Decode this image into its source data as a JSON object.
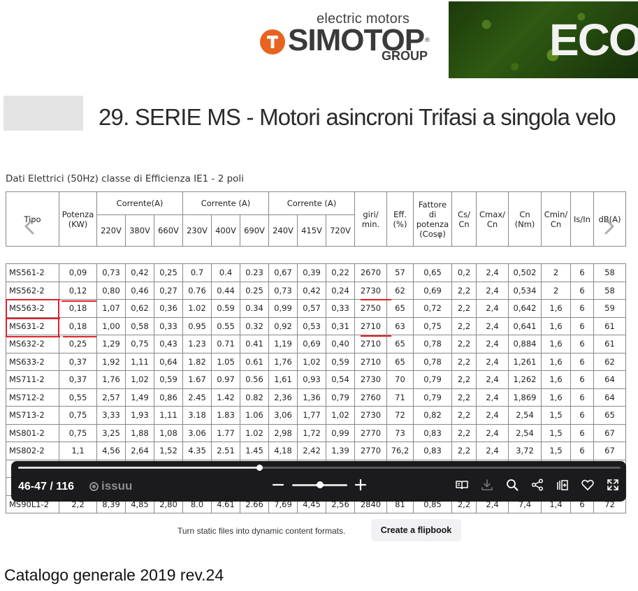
{
  "header": {
    "brand_tagline": "electric motors",
    "brand_name": "SIMOTOP",
    "brand_registered": "®",
    "brand_group": "GROUP",
    "eco_label": "ECO"
  },
  "page": {
    "section_title": "29. SERIE MS - Motori asincroni Trifasi a singola velo",
    "table_caption": "Dati Elettrici (50Hz) classe di Efficienza IE1 - 2 poli"
  },
  "table": {
    "headers": {
      "tipo": "Tipo",
      "potenza": "Potenza",
      "potenza_unit": "(KW)",
      "corrente_a": "Corrente(A)",
      "corrente_b": "Corrente (A)",
      "corrente_c": "Corrente (A)",
      "giri": "giri/",
      "giri_unit": "min.",
      "eff": "Eff.",
      "eff_unit": "(%)",
      "fattore": "Fattore",
      "fattore_2": "di",
      "fattore_3": "potenza",
      "fattore_4": "(Cosφ)",
      "cs": "Cs/",
      "cs_2": "Cn",
      "cmax": "Cmax/",
      "cmax_2": "Cn",
      "cn": "Cn",
      "cn_2": "(Nm)",
      "cmin": "Cmin/",
      "cmin_2": "Cn",
      "isin": "Is/In",
      "db": "dB(A)",
      "v": [
        "220V",
        "380V",
        "660V",
        "230V",
        "400V",
        "690V",
        "240V",
        "415V",
        "720V"
      ]
    },
    "rows": [
      [
        "MS561-2",
        "0,09",
        "0,73",
        "0,42",
        "0,25",
        "0.7",
        "0.4",
        "0.23",
        "0,67",
        "0,39",
        "0,22",
        "2670",
        "57",
        "0,65",
        "0,2",
        "2,4",
        "0,502",
        "2",
        "6",
        "58"
      ],
      [
        "MS562-2",
        "0,12",
        "0,80",
        "0,46",
        "0,27",
        "0.76",
        "0.44",
        "0.25",
        "0,73",
        "0,42",
        "0,24",
        "2730",
        "62",
        "0,69",
        "2,2",
        "2,4",
        "0,534",
        "2",
        "6",
        "58"
      ],
      [
        "MS563-2",
        "0,18",
        "1,07",
        "0,62",
        "0,36",
        "1.02",
        "0.59",
        "0.34",
        "0,99",
        "0,57",
        "0,33",
        "2750",
        "65",
        "0,72",
        "2,2",
        "2,4",
        "0,642",
        "1,6",
        "6",
        "59"
      ],
      [
        "MS631-2",
        "0,18",
        "1,00",
        "0,58",
        "0,33",
        "0.95",
        "0.55",
        "0.32",
        "0,92",
        "0,53",
        "0,31",
        "2710",
        "63",
        "0,75",
        "2,2",
        "2,4",
        "0,641",
        "1,6",
        "6",
        "61"
      ],
      [
        "MS632-2",
        "0,25",
        "1,29",
        "0,75",
        "0,43",
        "1.23",
        "0.71",
        "0.41",
        "1,19",
        "0,69",
        "0,40",
        "2710",
        "65",
        "0,78",
        "2,2",
        "2,4",
        "0,884",
        "1,6",
        "6",
        "61"
      ],
      [
        "MS633-2",
        "0,37",
        "1,92",
        "1,11",
        "0,64",
        "1.82",
        "1.05",
        "0.61",
        "1,76",
        "1,02",
        "0,59",
        "2710",
        "65",
        "0,78",
        "2,2",
        "2,4",
        "1,261",
        "1,6",
        "6",
        "62"
      ],
      [
        "MS711-2",
        "0,37",
        "1,76",
        "1,02",
        "0,59",
        "1.67",
        "0.97",
        "0.56",
        "1,61",
        "0,93",
        "0,54",
        "2730",
        "70",
        "0,79",
        "2,2",
        "2,4",
        "1,262",
        "1,6",
        "6",
        "64"
      ],
      [
        "MS712-2",
        "0,55",
        "2,57",
        "1,49",
        "0,86",
        "2.45",
        "1.42",
        "0.82",
        "2,36",
        "1,36",
        "0,79",
        "2760",
        "71",
        "0,79",
        "2,2",
        "2,4",
        "1,869",
        "1,6",
        "6",
        "64"
      ],
      [
        "MS713-2",
        "0,75",
        "3,33",
        "1,93",
        "1,11",
        "3.18",
        "1.83",
        "1.06",
        "3,06",
        "1,77",
        "1,02",
        "2730",
        "72",
        "0,82",
        "2,2",
        "2,4",
        "2,54",
        "1,5",
        "6",
        "65"
      ],
      [
        "MS801-2",
        "0,75",
        "3,25",
        "1,88",
        "1,08",
        "3.06",
        "1.77",
        "1.02",
        "2,98",
        "1,72",
        "0,99",
        "2770",
        "73",
        "0,83",
        "2,2",
        "2,4",
        "2,54",
        "1,5",
        "6",
        "67"
      ],
      [
        "MS802-2",
        "1,1",
        "4,56",
        "2,64",
        "1,52",
        "4.35",
        "2.51",
        "1.45",
        "4,18",
        "2,42",
        "1,39",
        "2770",
        "76,2",
        "0,83",
        "2,2",
        "2,4",
        "3,72",
        "1,5",
        "6",
        "67"
      ],
      [
        "",
        "",
        "",
        "",
        "",
        "",
        "",
        "",
        "",
        "",
        "",
        "",
        "",
        "",
        "",
        "",
        "",
        "",
        "",
        ""
      ],
      [
        "",
        "",
        "",
        "",
        "",
        "",
        "",
        "",
        "",
        "",
        "",
        "",
        "",
        "",
        "",
        "",
        "",
        "",
        "",
        ""
      ],
      [
        "MS90L1-2",
        "2,2",
        "8,39",
        "4,85",
        "2,80",
        "8.0",
        "4.61",
        "2.66",
        "7,69",
        "4,45",
        "2,56",
        "2840",
        "81",
        "0,85",
        "2,2",
        "2,4",
        "7,4",
        "1,4",
        "6",
        "72"
      ]
    ]
  },
  "viewer": {
    "page_count": "46-47 / 116",
    "brand": "issuu",
    "progress": 0.4,
    "zoom_level": 0.5,
    "icons": [
      "reader-mode-icon",
      "download-icon",
      "search-icon",
      "share-icon",
      "add-to-stack-icon",
      "like-icon",
      "fullscreen-icon"
    ]
  },
  "promo": {
    "text": "Turn static files into dynamic content formats.",
    "button_label": "Create a flipbook"
  },
  "doc_title": "Catalogo generale 2019 rev.24"
}
